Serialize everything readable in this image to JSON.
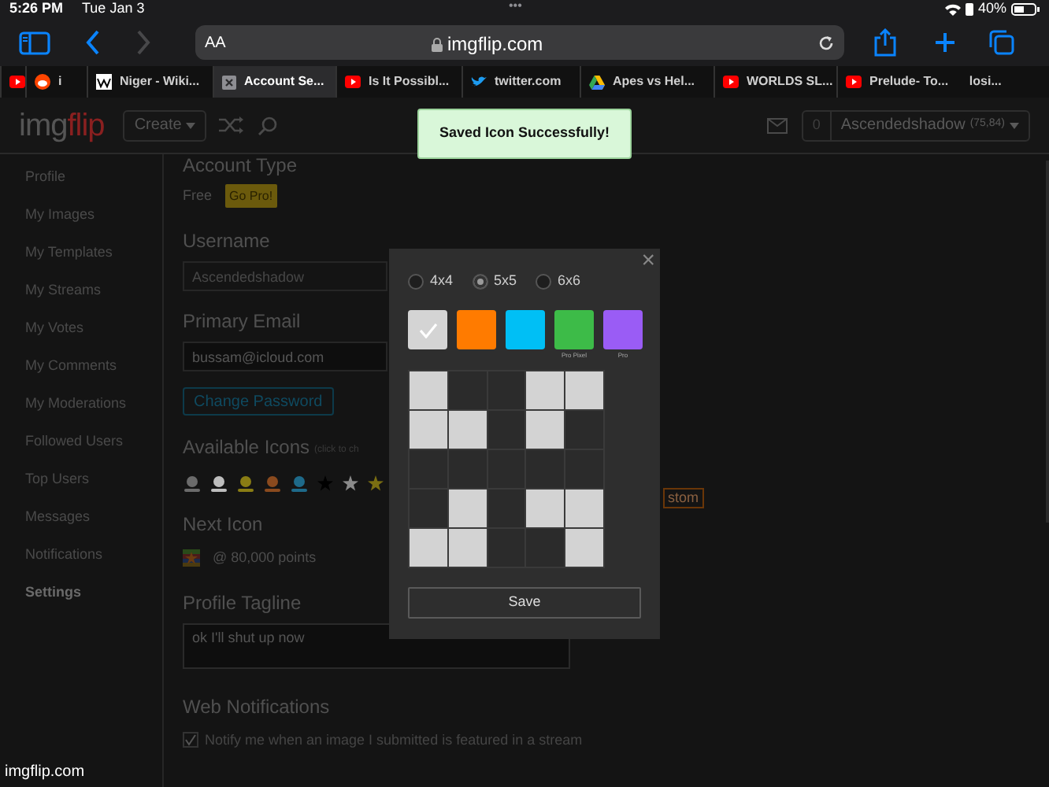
{
  "status_bar": {
    "time": "5:26 PM",
    "date": "Tue Jan 3",
    "dots": "•••",
    "battery": "40%"
  },
  "toolbar": {
    "text_size": "AA",
    "url": "imgflip.com"
  },
  "browser_tabs": [
    {
      "kind": "video",
      "selected": false
    },
    {
      "kind": "forum",
      "label": "i",
      "selected": false
    },
    {
      "kind": "wiki",
      "label": "Niger - Wiki...",
      "selected": false
    },
    {
      "kind": "close",
      "label": "Account Se...",
      "selected": true
    },
    {
      "kind": "video",
      "label": "Is It Possibl...",
      "selected": false
    },
    {
      "kind": "bird",
      "label": "twitter.com",
      "selected": false
    },
    {
      "kind": "drive",
      "label": "Apes vs Hel...",
      "selected": false
    },
    {
      "kind": "video",
      "label": "WORLDS SL...",
      "selected": false
    },
    {
      "kind": "video",
      "label": "Prelude- To...      losi...",
      "selected": false
    }
  ],
  "header": {
    "logo": [
      "img",
      "flip"
    ],
    "create": "Create",
    "notifications": "0",
    "user": "Ascendedshadow",
    "user_points": "(75,84)"
  },
  "toast": "Saved Icon Successfully!",
  "sidebar": [
    {
      "label": "Profile",
      "selected": false
    },
    {
      "label": "My Images",
      "selected": false
    },
    {
      "label": "My Templates",
      "selected": false
    },
    {
      "label": "My Streams",
      "selected": false
    },
    {
      "label": "My Votes",
      "selected": false
    },
    {
      "label": "My Comments",
      "selected": false
    },
    {
      "label": "My Moderations",
      "selected": false
    },
    {
      "label": "Followed Users",
      "selected": false
    },
    {
      "label": "Top Users",
      "selected": false
    },
    {
      "label": "Messages",
      "selected": false
    },
    {
      "label": "Notifications",
      "selected": false
    },
    {
      "label": "Settings",
      "selected": true
    }
  ],
  "account_type": {
    "heading": "Account Type",
    "value": "Free",
    "button": "Go Pro!"
  },
  "username": {
    "heading": "Username",
    "value": "Ascendedshadow",
    "disabled": true
  },
  "email": {
    "heading": "Primary Email",
    "value": "bussam@icloud.com"
  },
  "change_password": "Change Password",
  "available_icons": {
    "heading": "Available Icons",
    "hint": "(click to ch",
    "custom": "stom",
    "icons": [
      {
        "kind": "person",
        "color": "#6b6b6b"
      },
      {
        "kind": "person",
        "color": "#bdbdbd"
      },
      {
        "kind": "person",
        "color": "#8a7d14"
      },
      {
        "kind": "person",
        "color": "#8a4a1e"
      },
      {
        "kind": "person",
        "color": "#1e6a8a"
      },
      {
        "kind": "star",
        "color": "#000000"
      },
      {
        "kind": "star",
        "color": "#8a8a8a"
      },
      {
        "kind": "star",
        "color": "#7a6e12"
      }
    ]
  },
  "next_icon": {
    "heading": "Next Icon",
    "points": "@ 80,000 points"
  },
  "tagline": {
    "heading": "Profile Tagline",
    "value": "ok I'll shut up now"
  },
  "web_notifications": {
    "heading": "Web Notifications",
    "option": "Notify me when an image I submitted is featured in a stream",
    "checked": true
  },
  "footer_url": "imgflip.com",
  "dialog": {
    "close": "×",
    "sizes": [
      {
        "label": "4x4",
        "selected": false
      },
      {
        "label": "5x5",
        "selected": true
      },
      {
        "label": "6x6",
        "selected": false
      }
    ],
    "colors": [
      {
        "color": "#d4d4d4",
        "selected": true
      },
      {
        "color": "#ff7b00",
        "selected": false
      },
      {
        "color": "#00bff5",
        "selected": false
      },
      {
        "color": "#3dbb48",
        "selected": false,
        "note": "Pro Pixel"
      },
      {
        "color": "#9a5cf5",
        "selected": false,
        "note": "Pro"
      }
    ],
    "grid": [
      [
        true,
        false,
        false,
        true,
        true
      ],
      [
        true,
        true,
        false,
        true,
        false
      ],
      [
        false,
        false,
        false,
        false,
        false
      ],
      [
        false,
        true,
        false,
        true,
        true
      ],
      [
        true,
        true,
        false,
        false,
        true
      ]
    ],
    "save": "Save"
  }
}
